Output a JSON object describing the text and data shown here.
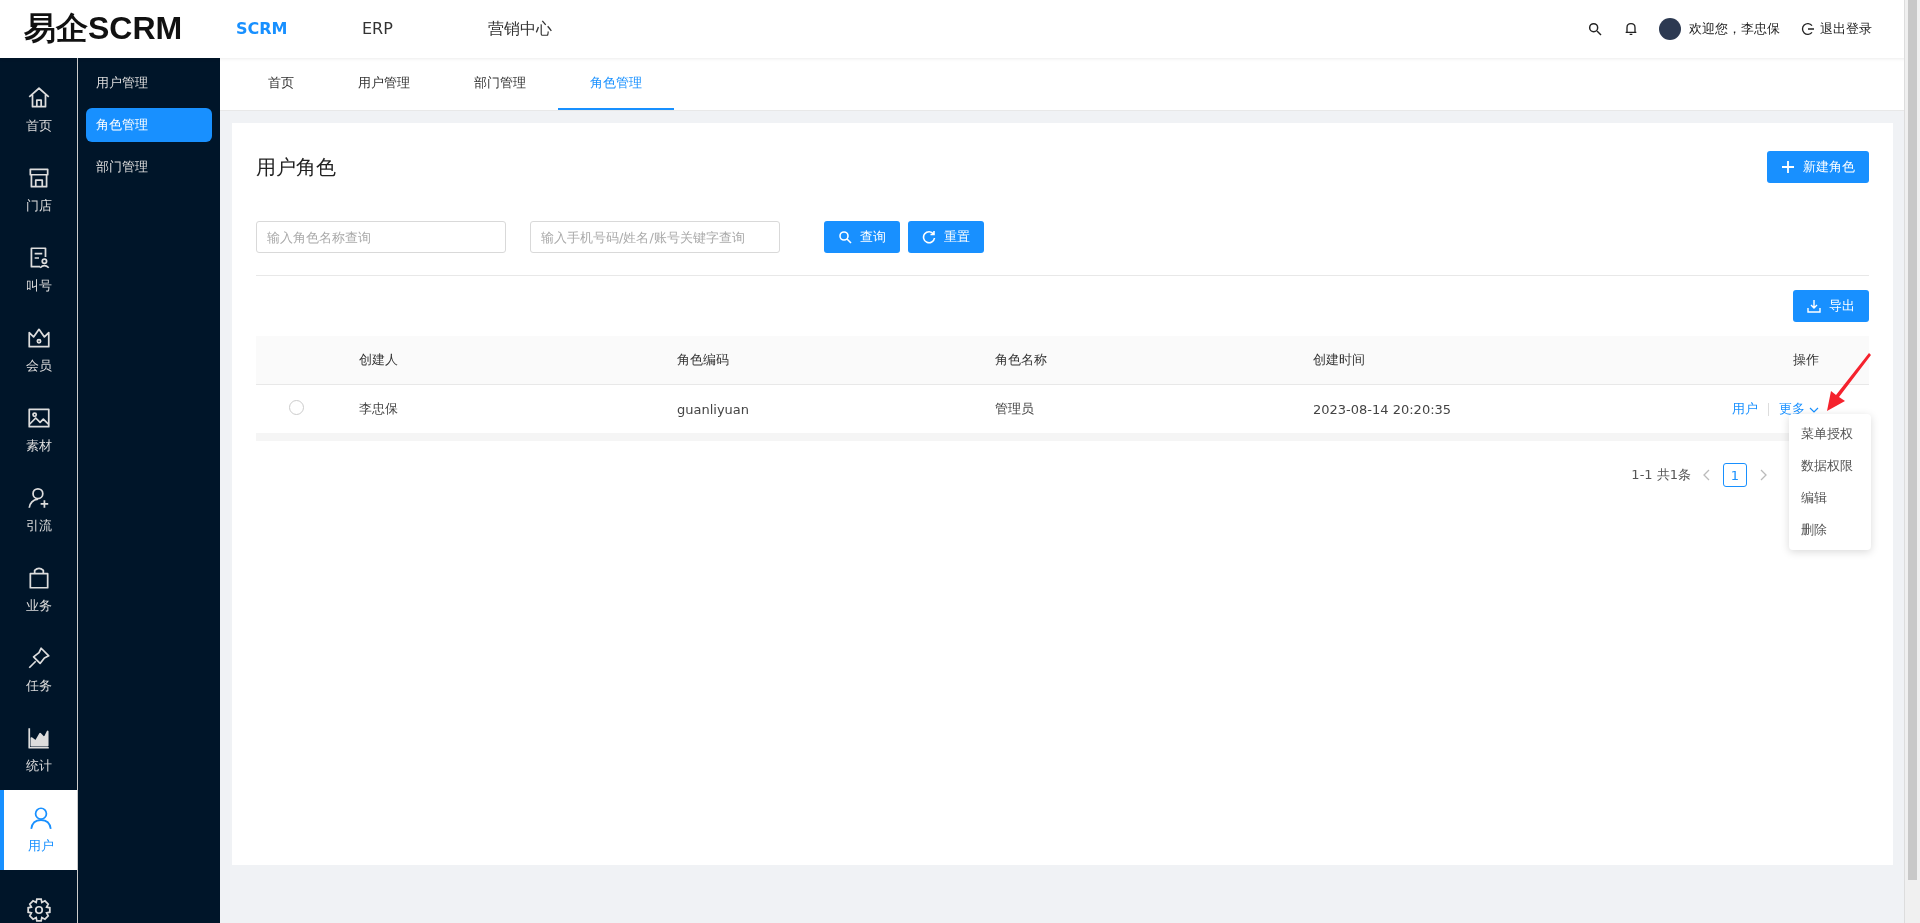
{
  "header": {
    "logo": "易企SCRM",
    "nav": [
      {
        "label": "SCRM",
        "selected": true
      },
      {
        "label": "ERP",
        "selected": false
      },
      {
        "label": "营销中心",
        "selected": false
      }
    ],
    "welcome": "欢迎您，李忠保",
    "logout": "退出登录"
  },
  "icon_sidebar": [
    {
      "label": "首页",
      "selected": false
    },
    {
      "label": "门店",
      "selected": false
    },
    {
      "label": "叫号",
      "selected": false
    },
    {
      "label": "会员",
      "selected": false
    },
    {
      "label": "素材",
      "selected": false
    },
    {
      "label": "引流",
      "selected": false
    },
    {
      "label": "业务",
      "selected": false
    },
    {
      "label": "任务",
      "selected": false
    },
    {
      "label": "统计",
      "selected": false
    },
    {
      "label": "用户",
      "selected": true
    }
  ],
  "sub_sidebar": [
    {
      "label": "用户管理",
      "selected": false
    },
    {
      "label": "角色管理",
      "selected": true
    },
    {
      "label": "部门管理",
      "selected": false
    }
  ],
  "tabs": [
    {
      "label": "首页",
      "selected": false
    },
    {
      "label": "用户管理",
      "selected": false
    },
    {
      "label": "部门管理",
      "selected": false
    },
    {
      "label": "角色管理",
      "selected": true
    }
  ],
  "page": {
    "title": "用户角色",
    "new_button": "新建角色",
    "search": [
      {
        "placeholder": "输入角色名称查询"
      },
      {
        "placeholder": "输入手机号码/姓名/账号关键字查询"
      }
    ],
    "query_button": "查询",
    "reset_button": "重置",
    "export_button": "导出"
  },
  "table": {
    "columns": [
      "创建人",
      "角色编码",
      "角色名称",
      "创建时间",
      "操作"
    ],
    "rows": [
      {
        "selected": false,
        "cells": [
          "李忠保",
          "guanliyuan",
          "管理员",
          "2023-08-14 20:20:35"
        ],
        "actions": [
          "用户",
          "更多"
        ]
      }
    ]
  },
  "pagination": {
    "summary": "1-1 共1条",
    "pages": [
      {
        "label": "1",
        "selected": true
      }
    ]
  },
  "dropdown": {
    "items": [
      "菜单授权",
      "数据权限",
      "编辑",
      "删除"
    ]
  }
}
